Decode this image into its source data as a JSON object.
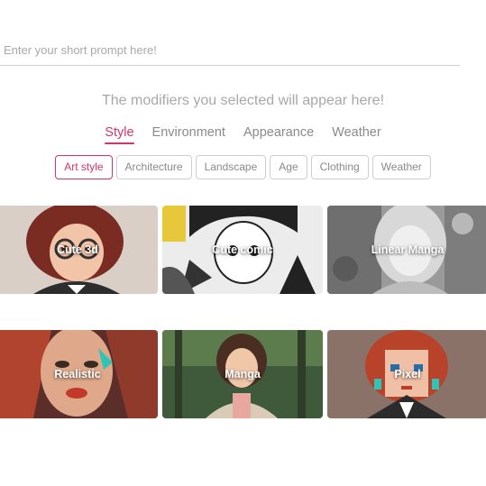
{
  "prompt": {
    "placeholder": "Enter your short prompt here!"
  },
  "modifiers_hint": "The modifiers you selected will appear here!",
  "tabs": [
    {
      "label": "Style",
      "active": true
    },
    {
      "label": "Environment"
    },
    {
      "label": "Appearance"
    },
    {
      "label": "Weather"
    }
  ],
  "chips": [
    {
      "label": "Art style",
      "active": true
    },
    {
      "label": "Architecture"
    },
    {
      "label": "Landscape"
    },
    {
      "label": "Age"
    },
    {
      "label": "Clothing"
    },
    {
      "label": "Weather"
    }
  ],
  "cards": [
    {
      "label": "Cute 3d"
    },
    {
      "label": "Cute comic"
    },
    {
      "label": "Linear Manga"
    },
    {
      "label": "Realistic"
    },
    {
      "label": "Manga"
    },
    {
      "label": "Pixel"
    }
  ],
  "colors": {
    "accent": "#d6336c",
    "muted_text": "#8a8a8a",
    "border": "#cfcfcf"
  }
}
